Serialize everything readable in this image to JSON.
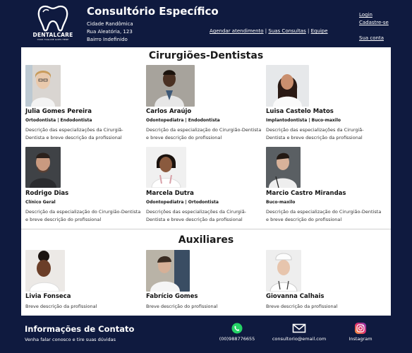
{
  "header": {
    "logo_text": "DENTALCARE",
    "logo_tagline": "YOUR TAGLINE GOES HERE",
    "title": "Consultório Específico",
    "address": [
      "Cidade Randômica",
      "Rua Aleatória, 123",
      "Bairro Indefinido"
    ],
    "nav": {
      "agendar": "Agendar atendimento",
      "consultas": "Suas Consultas",
      "equipe": "Equipe",
      "separator": " | "
    },
    "login": "Login",
    "cadastre": "Cadastre-se",
    "conta": "Sua conta"
  },
  "sections": {
    "dentists_title": "Cirurgiões-Dentistas",
    "auxiliaries_title": "Auxiliares"
  },
  "dentists": [
    {
      "name": "Julia Gomes Pereira",
      "spec": "Ortodontista | Endodontista",
      "desc": "Descrição das especializações da Cirurgiã-Dentista e breve descrição da profissional"
    },
    {
      "name": "Carlos Araújo",
      "spec": "Odontopediatra | Endodontista",
      "desc": "Descrição da especialização do Cirurgião-Dentista e breve descrição do profissional"
    },
    {
      "name": "Luisa Castelo Matos",
      "spec": "Implantodontista | Buco-maxilo",
      "desc": "Descrição das especializações da Cirurgiã-Dentista e breve descrição da profissional"
    },
    {
      "name": "Rodrigo Dias",
      "spec": "Clínico Geral",
      "desc": "Descrição da especialização do Cirurgião-Dentista e breve descrição do profissional"
    },
    {
      "name": "Marcela Dutra",
      "spec": "Odontopediatra | Ortodontista",
      "desc": "Descrições das especializações da Cirurgiã-Dentista e breve descrição da profissional"
    },
    {
      "name": "Marcio Castro Mirandas",
      "spec": "Buco-maxilo",
      "desc": "Descrição da especialização do Cirurgião-Dentista e breve descrição do profissional"
    }
  ],
  "auxiliaries": [
    {
      "name": "Livia Fonseca",
      "desc": "Breve descrição da profissional"
    },
    {
      "name": "Fabrício Gomes",
      "desc": "Breve descrição do profissional"
    },
    {
      "name": "Giovanna Calhais",
      "desc": "Breve descrição da profissional"
    }
  ],
  "footer": {
    "title": "Informações de Contato",
    "subtitle": "Venha falar conosco e tire suas dúvidas",
    "whatsapp": "(00)988776655",
    "email": "consultorio@email.com",
    "instagram": "Instagram"
  },
  "icons": {
    "logo": "tooth-icon",
    "whatsapp": "whatsapp-icon",
    "email": "envelope-icon",
    "instagram": "instagram-icon",
    "photo": "person-photo"
  },
  "colors": {
    "navy": "#0f1a3f",
    "whatsapp": "#25d366",
    "panel": "#ffffff"
  }
}
